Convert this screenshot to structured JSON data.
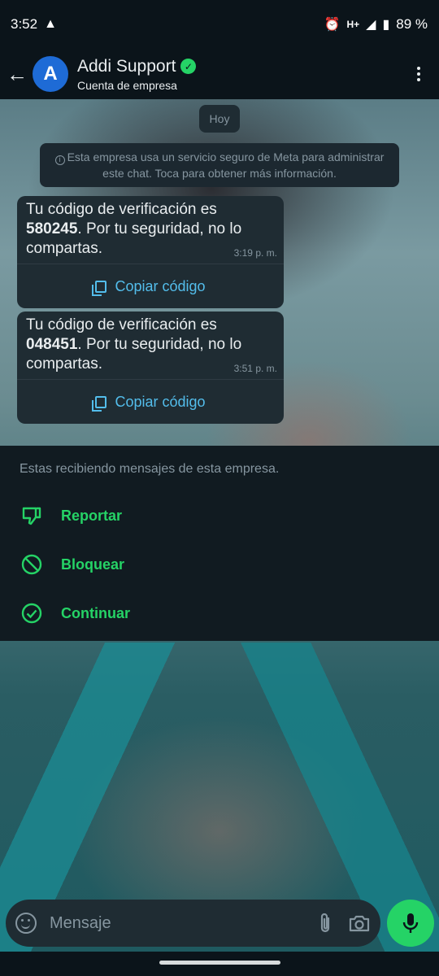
{
  "status_bar": {
    "time": "3:52",
    "network": "H+",
    "battery": "89 %"
  },
  "header": {
    "title": "Addi Support",
    "subtitle": "Cuenta de empresa",
    "avatar_letter": "A"
  },
  "chat": {
    "date_chip": "Hoy",
    "notice": "Esta empresa usa un servicio seguro de Meta para administrar este chat. Toca para obtener más información.",
    "messages": [
      {
        "text_before": "Tu código de verificación es ",
        "code": "580245",
        "text_after": ". Por tu seguridad, no lo compartas.",
        "time": "3:19 p. m.",
        "copy_label": "Copiar código"
      },
      {
        "text_before": "Tu código de verificación es ",
        "code": "048451",
        "text_after": ". Por tu seguridad, no lo compartas.",
        "time": "3:51 p. m.",
        "copy_label": "Copiar código"
      }
    ]
  },
  "panel": {
    "message": "Estas recibiendo mensajes de esta empresa.",
    "actions": [
      {
        "label": "Reportar",
        "icon": "thumbs-down-icon"
      },
      {
        "label": "Bloquear",
        "icon": "block-icon"
      },
      {
        "label": "Continuar",
        "icon": "check-circle-icon"
      }
    ]
  },
  "input": {
    "placeholder": "Mensaje"
  },
  "colors": {
    "accent_green": "#25d366",
    "link_blue": "#53bdeb",
    "bubble_bg": "#1f2c33",
    "app_bg": "#0b141a"
  }
}
